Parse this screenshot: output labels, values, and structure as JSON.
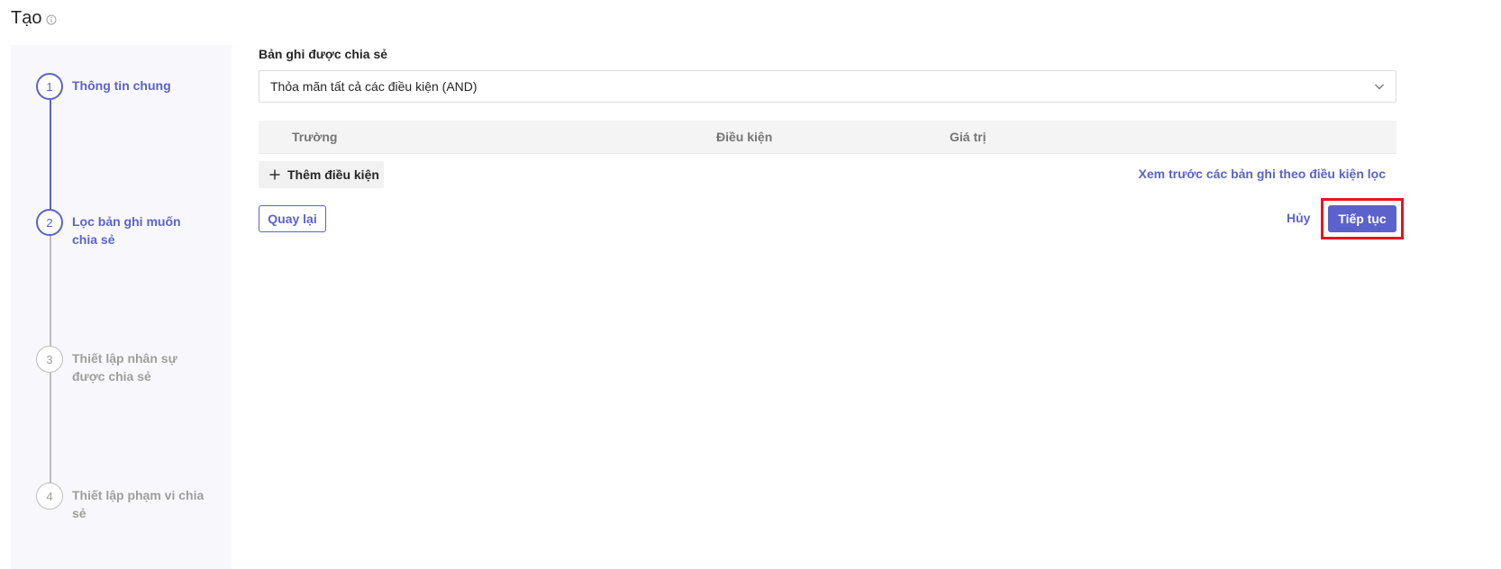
{
  "page": {
    "title": "Tạo"
  },
  "stepper": {
    "steps": [
      {
        "number": "1",
        "label": "Thông tin chung",
        "state": "active"
      },
      {
        "number": "2",
        "label": "Lọc bản ghi muốn chia sẻ",
        "state": "active"
      },
      {
        "number": "3",
        "label": "Thiết lập nhân sự được chia sẻ",
        "state": "inactive"
      },
      {
        "number": "4",
        "label": "Thiết lập phạm vi chia sẻ",
        "state": "inactive"
      }
    ]
  },
  "filter": {
    "section_label": "Bản ghi được chia sẻ",
    "match_select": {
      "value": "Thỏa mãn tất cả các điều kiện (AND)"
    },
    "table": {
      "columns": [
        "Trường",
        "Điều kiện",
        "Giá trị"
      ]
    },
    "add_condition_label": "Thêm điều kiện",
    "preview_link": "Xem trước các bản ghi theo điều kiện lọc"
  },
  "actions": {
    "back_label": "Quay lại",
    "cancel_label": "Hủy",
    "continue_label": "Tiếp tục"
  },
  "colors": {
    "accent": "#5b62cc",
    "highlight_border": "#e6141e",
    "inactive": "#bdbdbd"
  }
}
